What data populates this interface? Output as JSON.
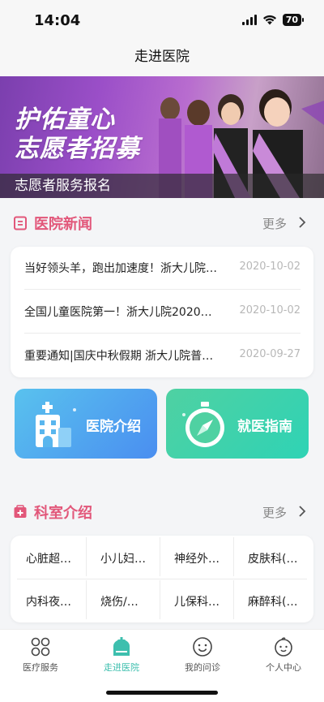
{
  "status_bar": {
    "time": "14:04",
    "battery": "70"
  },
  "nav": {
    "title": "走进医院"
  },
  "banner": {
    "title_line1": "护佑童心",
    "title_line2": "志愿者招募",
    "caption": "志愿者服务报名"
  },
  "news": {
    "title": "医院新闻",
    "more": "更多",
    "items": [
      {
        "text": "当好领头羊，跑出加速度！浙大儿院…",
        "date": "2020-10-02"
      },
      {
        "text": "全国儿童医院第一！浙大儿院2020…",
        "date": "2020-10-02"
      },
      {
        "text": "重要通知|国庆中秋假期 浙大儿院普…",
        "date": "2020-09-27"
      }
    ]
  },
  "quick_links": {
    "intro": "医院介绍",
    "guide": "就医指南"
  },
  "departments": {
    "title": "科室介绍",
    "more": "更多",
    "items": [
      "心脏超…",
      "小儿妇…",
      "神经外…",
      "皮肤科(…",
      "内科夜…",
      "烧伤/…",
      "儿保科…",
      "麻醉科(…"
    ]
  },
  "tabs": [
    {
      "label": "医疗服务",
      "icon": "grid-icon"
    },
    {
      "label": "走进医院",
      "icon": "hospital-icon"
    },
    {
      "label": "我的问诊",
      "icon": "smile-icon"
    },
    {
      "label": "个人中心",
      "icon": "baby-face-icon"
    }
  ],
  "colors": {
    "accent_pink": "#e2577a",
    "accent_teal": "#3dbfae",
    "card_blue": "#4a8ef0",
    "card_green": "#2fd3b5"
  }
}
